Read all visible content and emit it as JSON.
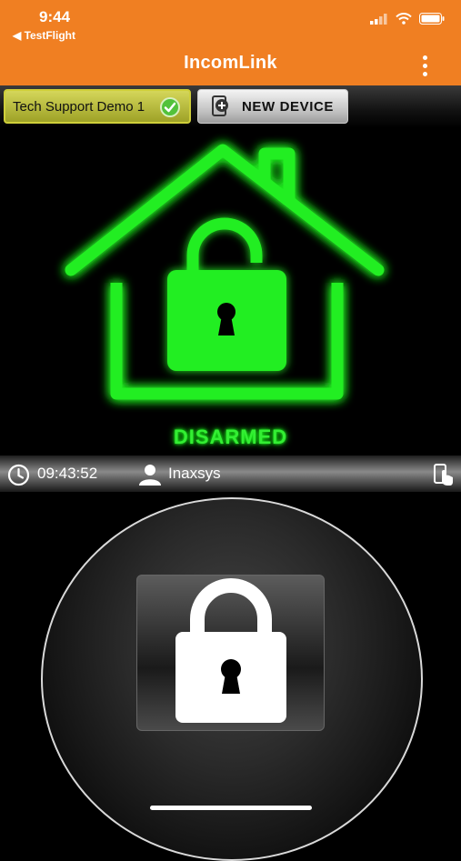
{
  "status_bar": {
    "time": "9:44",
    "back_label": "◀ TestFlight"
  },
  "app_bar": {
    "title": "IncomLink"
  },
  "device_tabs": {
    "active_device": "Tech Support Demo 1",
    "new_device_label": "NEW DEVICE"
  },
  "security": {
    "state": "DISARMED",
    "glow_color": "#1aff1a"
  },
  "info_bar": {
    "time": "09:43:52",
    "user": "Inaxsys"
  },
  "colors": {
    "accent": "#f07f22",
    "disarmed_green": "#33ee33",
    "device_tab": "#c8ca46"
  },
  "icons": [
    "wifi-icon",
    "signal-icon",
    "battery-icon",
    "kebab-menu-icon",
    "check-icon",
    "add-device-icon",
    "house-icon",
    "unlocked-padlock-icon",
    "clock-icon",
    "user-icon",
    "phone-touch-icon",
    "locked-padlock-icon"
  ]
}
